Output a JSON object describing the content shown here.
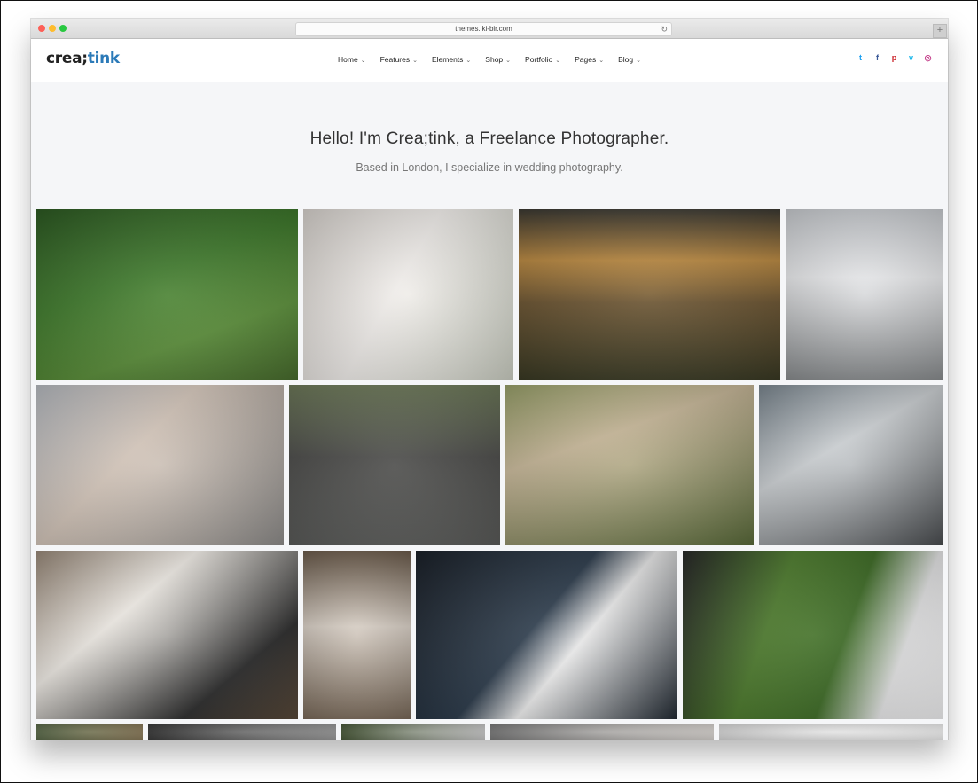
{
  "browser": {
    "url": "themes.iki-bir.com",
    "reload_icon": "reload-icon",
    "newtab_icon": "plus-icon"
  },
  "site": {
    "logo_part1": "crea;",
    "logo_part2": "tink",
    "brand_color": "#2b7ab8"
  },
  "nav": {
    "items": [
      {
        "label": "Home"
      },
      {
        "label": "Features"
      },
      {
        "label": "Elements"
      },
      {
        "label": "Shop"
      },
      {
        "label": "Portfolio"
      },
      {
        "label": "Pages"
      },
      {
        "label": "Blog"
      }
    ],
    "chevron": "⌄"
  },
  "socials": [
    {
      "icon": "twitter-icon",
      "glyph": "t",
      "color": "#1da1f2"
    },
    {
      "icon": "facebook-icon",
      "glyph": "f",
      "color": "#3b5998"
    },
    {
      "icon": "pinterest-icon",
      "glyph": "p",
      "color": "#cb2027"
    },
    {
      "icon": "vimeo-icon",
      "glyph": "v",
      "color": "#1ab7ea"
    },
    {
      "icon": "instagram-icon",
      "glyph": "◎",
      "color": "#c13584"
    }
  ],
  "hero": {
    "title": "Hello! I'm Crea;tink, a Freelance Photographer.",
    "subtitle": "Based in London, I specialize in wedding photography."
  },
  "gallery": [
    {
      "name": "photo-bride-guests"
    },
    {
      "name": "photo-necklace-dress"
    },
    {
      "name": "photo-couple-sunset-lake"
    },
    {
      "name": "photo-couple-kiss-platform"
    },
    {
      "name": "photo-hands-rings"
    },
    {
      "name": "photo-groom-bowtie"
    },
    {
      "name": "photo-couple-dock"
    },
    {
      "name": "photo-couple-veil"
    },
    {
      "name": "photo-bride-bouquet-embrace"
    },
    {
      "name": "photo-bride-flower-crown"
    },
    {
      "name": "photo-groom-boutonniere"
    },
    {
      "name": "photo-shoes-grass-lace"
    },
    {
      "name": "photo-row4-1"
    },
    {
      "name": "photo-row4-2"
    },
    {
      "name": "photo-row4-3"
    },
    {
      "name": "photo-row4-4"
    },
    {
      "name": "photo-row4-5"
    }
  ]
}
